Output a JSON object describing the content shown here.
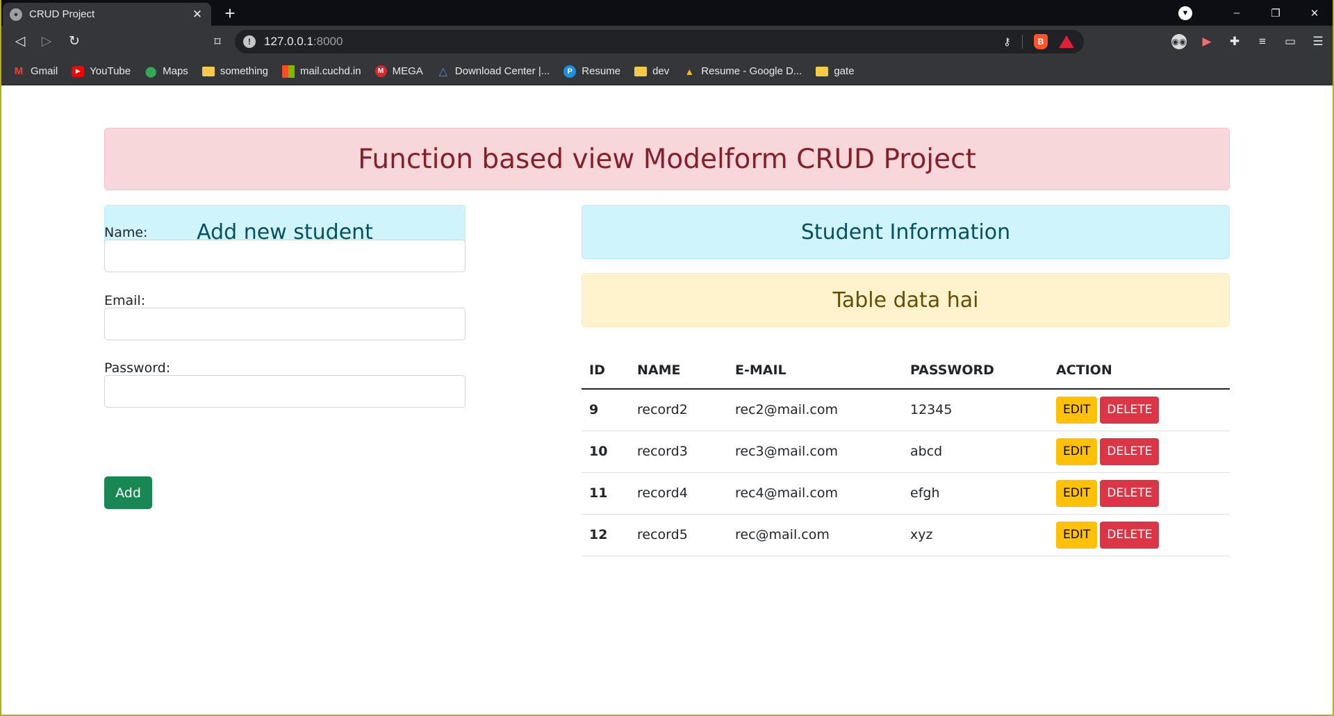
{
  "browser": {
    "tab_title": "CRUD Project",
    "tab_close": "✕",
    "new_tab": "+",
    "url_host": "127.0.0.1",
    "url_port": ":8000",
    "window_controls": {
      "minimize": "–",
      "restore": "❐",
      "close": "✕"
    },
    "bookmarks": [
      {
        "label": "Gmail",
        "icon": "gmail-icon"
      },
      {
        "label": "YouTube",
        "icon": "youtube-icon"
      },
      {
        "label": "Maps",
        "icon": "maps-icon"
      },
      {
        "label": "something",
        "icon": "folder-icon"
      },
      {
        "label": "mail.cuchd.in",
        "icon": "microsoft-icon"
      },
      {
        "label": "MEGA",
        "icon": "mega-icon"
      },
      {
        "label": "Download Center |...",
        "icon": "triangle-icon"
      },
      {
        "label": "Resume",
        "icon": "resume-icon"
      },
      {
        "label": "dev",
        "icon": "folder-icon"
      },
      {
        "label": "Resume - Google D...",
        "icon": "drive-icon"
      },
      {
        "label": "gate",
        "icon": "folder-icon"
      }
    ]
  },
  "page": {
    "hero_title": "Function based view Modelform CRUD Project",
    "form": {
      "heading": "Add new student",
      "name_label": "Name:",
      "email_label": "Email:",
      "password_label": "Password:",
      "name_value": "",
      "email_value": "",
      "password_value": "",
      "submit_label": "Add"
    },
    "info": {
      "heading": "Student Information",
      "note": "Table data hai",
      "columns": [
        "ID",
        "NAME",
        "E-MAIL",
        "PASSWORD",
        "ACTION"
      ],
      "edit_label": "EDIT",
      "delete_label": "DELETE",
      "rows": [
        {
          "id": "9",
          "name": "record2",
          "email": "rec2@mail.com",
          "password": "12345"
        },
        {
          "id": "10",
          "name": "record3",
          "email": "rec3@mail.com",
          "password": "abcd"
        },
        {
          "id": "11",
          "name": "record4",
          "email": "rec4@mail.com",
          "password": "efgh"
        },
        {
          "id": "12",
          "name": "record5",
          "email": "rec@mail.com",
          "password": "xyz"
        }
      ]
    }
  },
  "colors": {
    "success": "#198754",
    "warning": "#ffc107",
    "danger": "#dc3545",
    "alert_danger_bg": "#f8d7da",
    "alert_info_bg": "#cff4fc",
    "alert_warning_bg": "#fff3cd"
  }
}
